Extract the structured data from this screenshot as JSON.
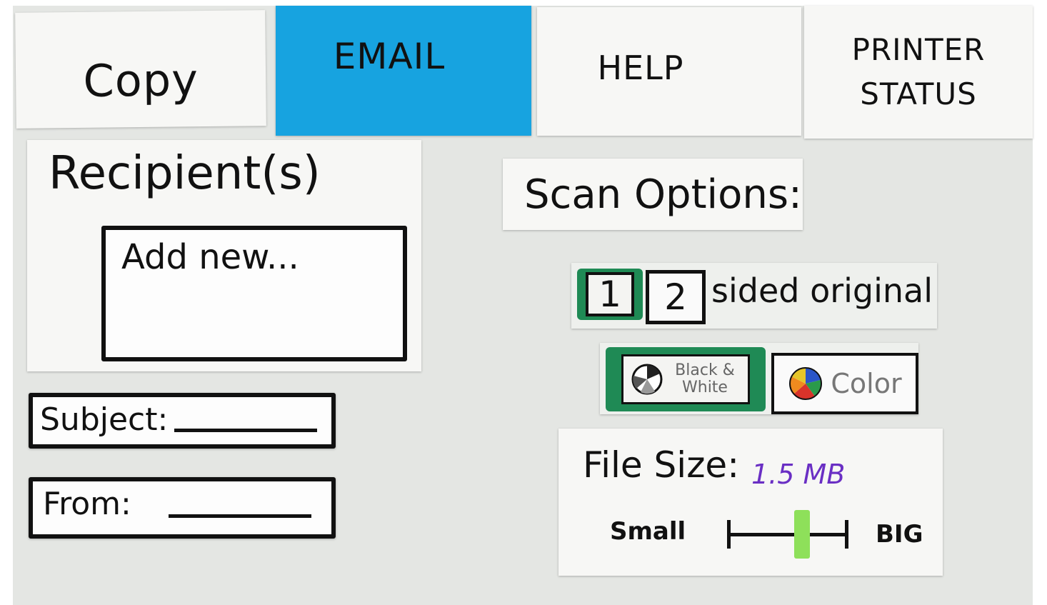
{
  "tabs": [
    {
      "label": "Copy",
      "active": false
    },
    {
      "label": "EMAIL",
      "active": true
    },
    {
      "label": "HELP",
      "active": false
    },
    {
      "label": "PRINTER STATUS",
      "active": false
    }
  ],
  "colors": {
    "active_tab": "#17a3e0",
    "selected_option": "#1f8a55",
    "slider_thumb": "#8ee05a",
    "file_size_value": "#6a2fc4"
  },
  "recipients": {
    "heading": "Recipient(s)",
    "add_new": "Add new..."
  },
  "fields": {
    "subject_label": "Subject:",
    "from_label": "From:"
  },
  "scan_options": {
    "heading": "Scan Options:",
    "sided": {
      "options": [
        "1",
        "2"
      ],
      "selected": "1",
      "suffix": "sided original"
    },
    "color_mode": {
      "bw_label": "Black & White",
      "bw_icon": "black-white-pie-icon",
      "color_label": "Color",
      "color_icon": "color-pie-icon",
      "selected": "Black & White"
    },
    "file_size": {
      "label": "File Size:",
      "value": "1.5 MB",
      "min_label": "Small",
      "max_label": "BIG",
      "level": 0.62
    }
  }
}
